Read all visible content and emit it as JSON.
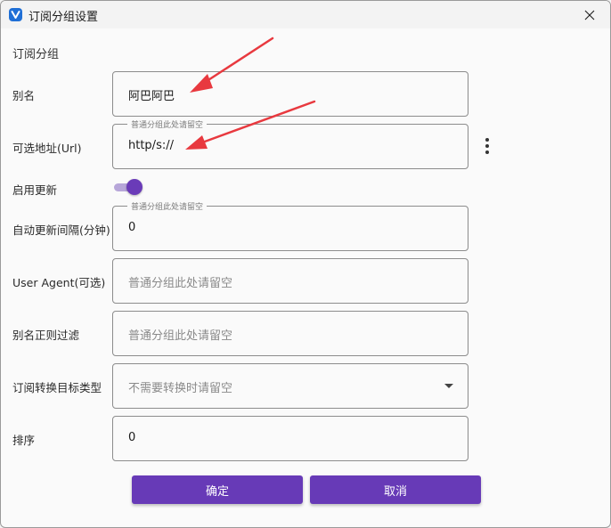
{
  "window": {
    "title": "订阅分组设置",
    "app_icon": "app-logo-icon",
    "close_icon": "close-icon"
  },
  "section": {
    "title": "订阅分组"
  },
  "fields": {
    "alias": {
      "label": "别名",
      "value": "阿巴阿巴"
    },
    "url": {
      "label": "可选地址(Url)",
      "legend": "普通分组此处请留空",
      "value": "http/s://"
    },
    "enable_update": {
      "label": "启用更新",
      "checked": true
    },
    "interval": {
      "label": "自动更新间隔(分钟)",
      "legend": "普通分组此处请留空",
      "value": "0"
    },
    "user_agent": {
      "label": "User Agent(可选)",
      "placeholder": "普通分组此处请留空"
    },
    "alias_regex": {
      "label": "别名正则过滤",
      "placeholder": "普通分组此处请留空"
    },
    "convert_target": {
      "label": "订阅转换目标类型",
      "placeholder": "不需要转换时请留空"
    },
    "sort": {
      "label": "排序",
      "value": "0"
    }
  },
  "buttons": {
    "confirm": "确定",
    "cancel": "取消"
  },
  "colors": {
    "accent": "#673ab7",
    "annotation_arrow": "#e8393f"
  }
}
